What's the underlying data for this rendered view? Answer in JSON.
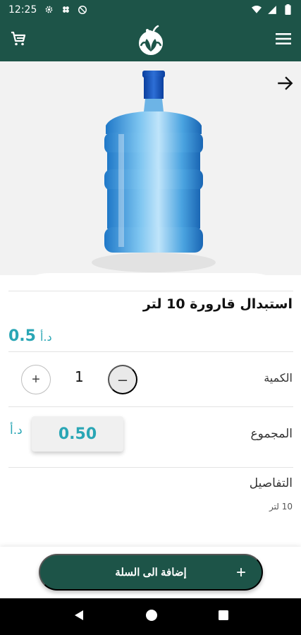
{
  "status_bar": {
    "time": "12:25"
  },
  "product": {
    "title": "استبدال قارورة 10 لتر",
    "price_amount": "0.5",
    "currency": "د.أ"
  },
  "quantity": {
    "label": "الكمية",
    "value": "1",
    "plus_label": "+",
    "minus_label": "–"
  },
  "total": {
    "label": "المجموع",
    "value": "0.50",
    "currency": "د.أ"
  },
  "details": {
    "label": "التفاصيل",
    "value": "10 لتر"
  },
  "cart_button": {
    "label": "إضافة الى السلة",
    "plus": "+"
  },
  "colors": {
    "primary": "#1d5448",
    "accent": "#2aa6b5"
  },
  "icons": [
    "wifi-icon",
    "signal-icon",
    "battery-icon",
    "cart-icon",
    "menu-icon",
    "back-arrow-icon",
    "nav-back-icon",
    "nav-home-icon",
    "nav-recents-icon"
  ]
}
